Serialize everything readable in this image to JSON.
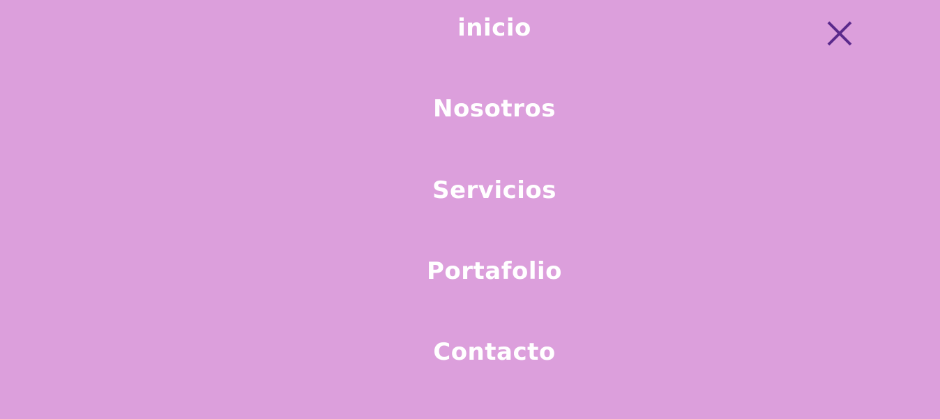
{
  "menu": {
    "items": [
      {
        "label": "inicio"
      },
      {
        "label": "Nosotros"
      },
      {
        "label": "Servicios"
      },
      {
        "label": "Portafolio"
      },
      {
        "label": "Contacto"
      }
    ],
    "close_icon": "close-icon"
  },
  "colors": {
    "background": "#DC9FDC",
    "link_text": "#FFFFFF",
    "close_icon": "#5B2A8C"
  }
}
